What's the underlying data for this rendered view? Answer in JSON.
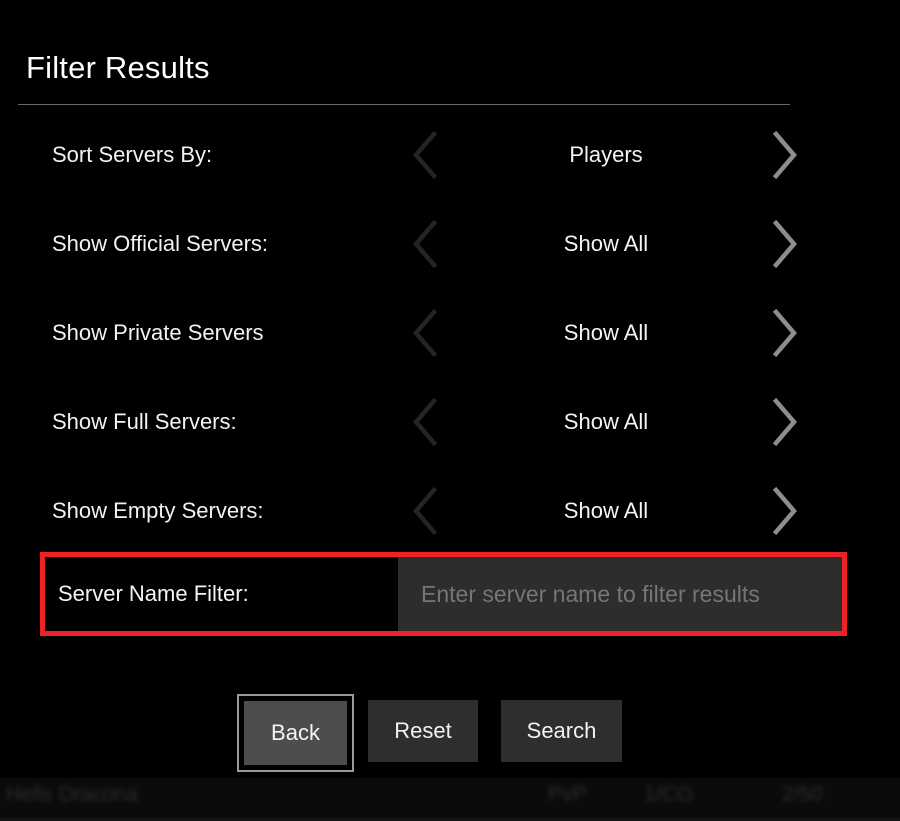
{
  "dialog": {
    "title": "Filter Results"
  },
  "filters": [
    {
      "label": "Sort Servers By:",
      "value": "Players"
    },
    {
      "label": "Show Official Servers:",
      "value": "Show All"
    },
    {
      "label": "Show Private Servers",
      "value": "Show All"
    },
    {
      "label": "Show Full Servers:",
      "value": "Show All"
    },
    {
      "label": "Show Empty Servers:",
      "value": "Show All"
    }
  ],
  "name_filter": {
    "label": "Server Name Filter:",
    "value": "",
    "placeholder": "Enter server name to filter results",
    "highlight_color": "#ec2227"
  },
  "buttons": {
    "back": "Back",
    "reset": "Reset",
    "search": "Search"
  },
  "background_row": {
    "name": "Hells Dracona",
    "mode": "PvP",
    "ping": "1/CO",
    "slots": "2/50"
  },
  "colors": {
    "background": "#000000",
    "text": "#f4f4f4",
    "chevron_left": "#242424",
    "chevron_right": "#8d8d8d",
    "input_background": "#2d2d2d",
    "placeholder": "#767676",
    "button_face": "#2e2e2e",
    "button_focused": "#4d4d4d",
    "focus_ring": "#9b9b9b"
  }
}
